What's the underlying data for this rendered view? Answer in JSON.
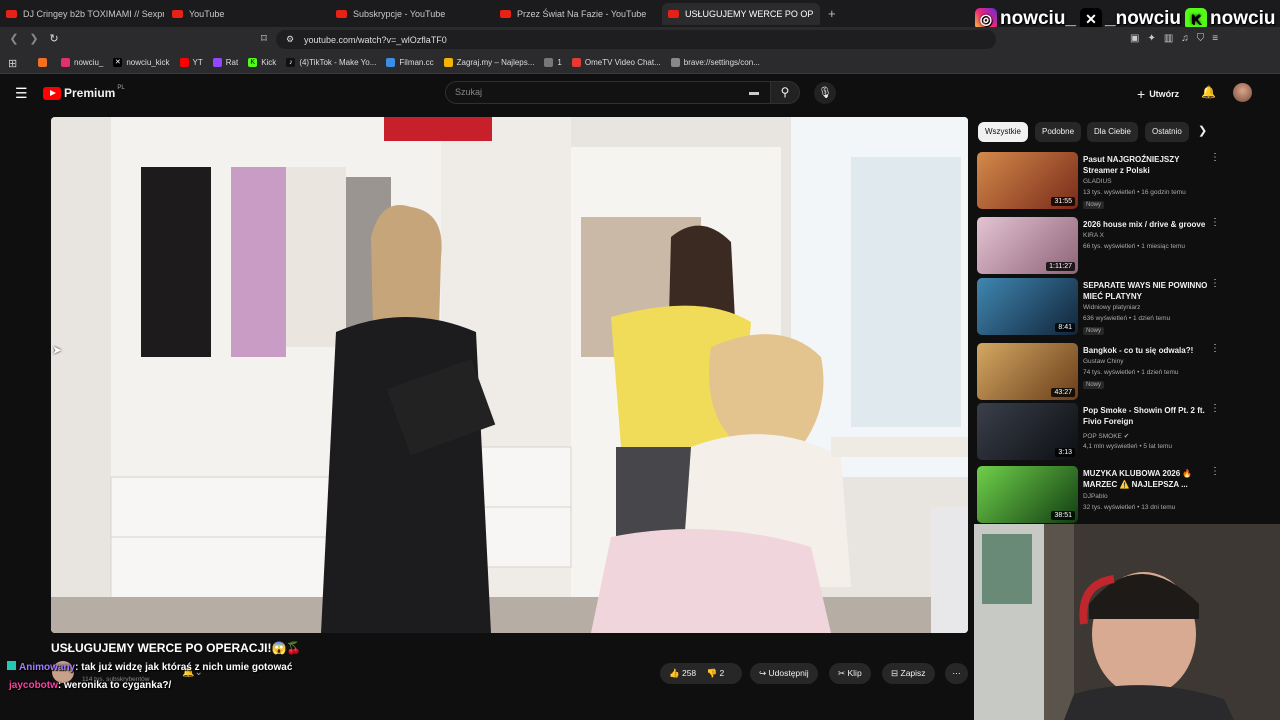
{
  "browser": {
    "tabs": [
      {
        "label": "DJ Cringey b2b TOXIMAMI // Sexpre",
        "active": false
      },
      {
        "label": "YouTube",
        "active": false
      },
      {
        "label": "Subskrypcje - YouTube",
        "active": false
      },
      {
        "label": "Przez Świat Na Fazie - YouTube",
        "active": false
      },
      {
        "label": "USŁUGUJEMY WERCE PO OP",
        "active": true
      }
    ],
    "url": "youtube.com/watch?v=_wlOzflaTF0",
    "bookmarks": [
      {
        "label": "",
        "color": "#f37021"
      },
      {
        "label": "nowciu_",
        "color": "#e1306c"
      },
      {
        "label": "nowciu_kick",
        "color": "#000000"
      },
      {
        "label": "YT",
        "color": "#ff0000"
      },
      {
        "label": "Rat",
        "color": "#9146ff"
      },
      {
        "label": "Kick",
        "color": "#53fc18"
      },
      {
        "label": "(4)TikTok - Make Yo...",
        "color": "#111111"
      },
      {
        "label": "Filman.cc",
        "color": "#3a8ee6"
      },
      {
        "label": "Zagraj.my – Najleps...",
        "color": "#f5b400"
      },
      {
        "label": "1",
        "color": "#777777"
      },
      {
        "label": "OmeTV Video Chat...",
        "color": "#e53935"
      },
      {
        "label": "brave://settings/con...",
        "color": "#888888"
      }
    ]
  },
  "overlay": {
    "instagram": "nowciu_",
    "x": "_nowciu",
    "kick": "nowciu"
  },
  "youtube": {
    "logo": "Premium",
    "region": "PL",
    "search_placeholder": "Szukaj",
    "create_label": "Utwórz",
    "chips": [
      "Wszystkie",
      "Podobne",
      "Dla Ciebie",
      "Ostatnio"
    ],
    "video_title": "USŁUGUJEMY WERCE PO OPERACJI!😱🍒",
    "subscribers": "114 tys. subskrybentów",
    "likes": "258",
    "dislikes": "2",
    "share": "Udostępnij",
    "clip": "Klip",
    "save": "Zapisz",
    "recommendations": [
      {
        "title": "Pasut NAJGROŹNIEJSZY Streamer z Polski",
        "channel": "GLADIUS",
        "meta": "13 tys. wyświetleń • 16 godzin temu",
        "badge": "Nowy",
        "duration": "31:55",
        "thumb": "#b04a2a"
      },
      {
        "title": "2026 house mix / drive & groove",
        "channel": "KIRA X",
        "meta": "66 tys. wyświetleń • 1 miesiąc temu",
        "badge": "",
        "duration": "1:11:27",
        "thumb": "#c7a5b8"
      },
      {
        "title": "SEPARATE WAYS NIE POWINNO MIEĆ PLATYNY",
        "channel": "Widniowy platyniarz",
        "meta": "636 wyświetleń • 1 dzień temu",
        "badge": "Nowy",
        "duration": "8:41",
        "thumb": "#2b5c7a"
      },
      {
        "title": "Bangkok - co tu się odwala?!",
        "channel": "Gustaw Chiny",
        "meta": "74 tys. wyświetleń • 1 dzień temu",
        "badge": "Nowy",
        "duration": "43:27",
        "thumb": "#a3743c"
      },
      {
        "title": "Pop Smoke - Showin Off Pt. 2 ft. Fivio Foreign",
        "channel": "POP SMOKE",
        "meta": "4,1 mln wyświetleń • 5 lat temu",
        "badge": "",
        "duration": "3:13",
        "thumb": "#20242c"
      },
      {
        "title": "MUZYKA KLUBOWA 2026 🔥 MARZEC ⚠️ NAJLEPSZA ...",
        "channel": "DJPablo",
        "meta": "32 tys. wyświetleń • 13 dni temu",
        "badge": "",
        "duration": "38:51",
        "thumb": "#3a8f2a"
      }
    ]
  },
  "chat": [
    {
      "user": "Animowany",
      "message": ": tak już widzę jak któraś z nich umie gotować",
      "color": "#a27bff"
    },
    {
      "user": "jaycobotw",
      "message": ": weronika to cyganka?/",
      "color": "#ff3fa4"
    }
  ]
}
